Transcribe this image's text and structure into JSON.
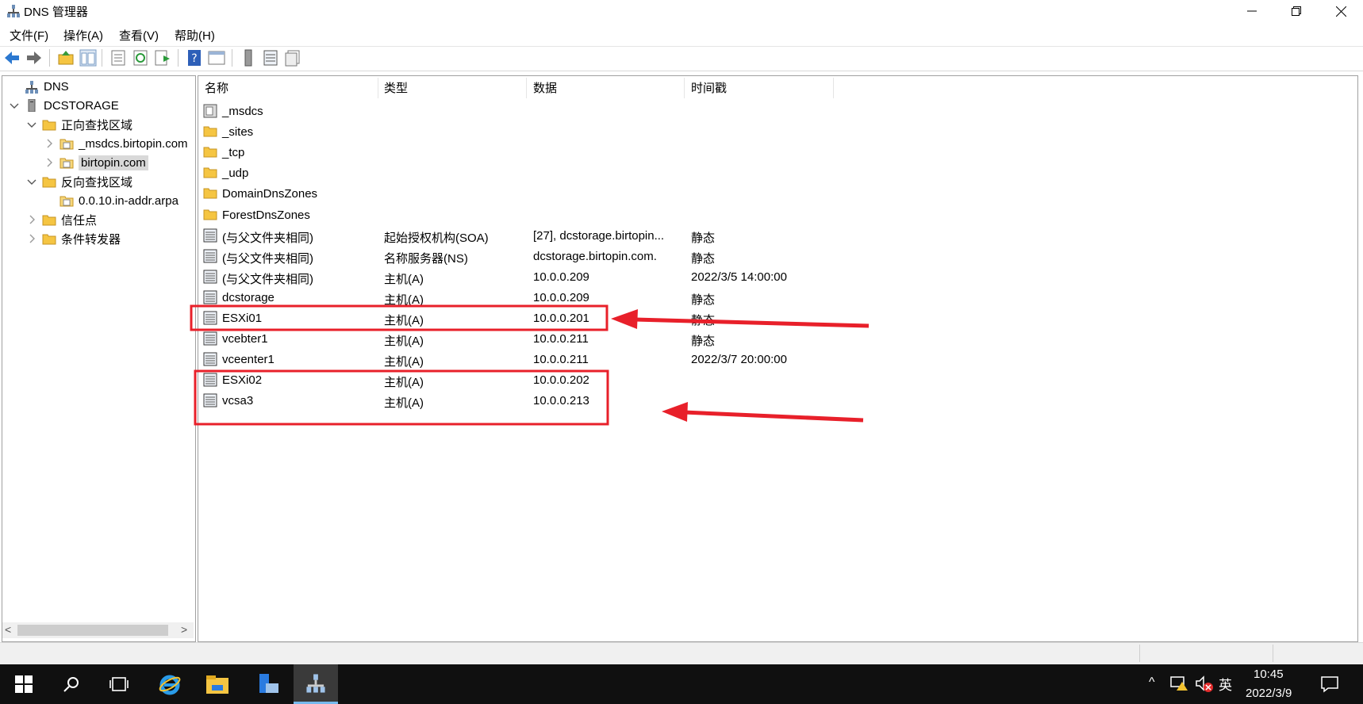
{
  "window": {
    "title": "DNS 管理器"
  },
  "menu": [
    "文件(F)",
    "操作(A)",
    "查看(V)",
    "帮助(H)"
  ],
  "tree": [
    {
      "label": "DNS",
      "level": 0,
      "expander": "",
      "icon": "dns-icon"
    },
    {
      "label": "DCSTORAGE",
      "level": 0,
      "expander": "v",
      "icon": "server-icon"
    },
    {
      "label": "正向查找区域",
      "level": 1,
      "expander": "v",
      "icon": "folder-icon"
    },
    {
      "label": "_msdcs.birtopin.com",
      "level": 2,
      "expander": ">",
      "icon": "zone-icon"
    },
    {
      "label": "birtopin.com",
      "level": 2,
      "expander": ">",
      "icon": "zone-icon",
      "selected": true
    },
    {
      "label": "反向查找区域",
      "level": 1,
      "expander": "v",
      "icon": "folder-icon"
    },
    {
      "label": "0.0.10.in-addr.arpa",
      "level": 2,
      "expander": "",
      "icon": "zone-icon"
    },
    {
      "label": "信任点",
      "level": 1,
      "expander": ">",
      "icon": "folder-icon"
    },
    {
      "label": "条件转发器",
      "level": 1,
      "expander": ">",
      "icon": "folder-icon"
    }
  ],
  "columns": [
    "名称",
    "类型",
    "数据",
    "时间戳"
  ],
  "rows": [
    {
      "name": "_msdcs",
      "type": "",
      "data": "",
      "timestamp": "",
      "icon": "delegated-zone-icon"
    },
    {
      "name": "_sites",
      "type": "",
      "data": "",
      "timestamp": "",
      "icon": "folder-icon"
    },
    {
      "name": "_tcp",
      "type": "",
      "data": "",
      "timestamp": "",
      "icon": "folder-icon"
    },
    {
      "name": "_udp",
      "type": "",
      "data": "",
      "timestamp": "",
      "icon": "folder-icon"
    },
    {
      "name": "DomainDnsZones",
      "type": "",
      "data": "",
      "timestamp": "",
      "icon": "folder-icon"
    },
    {
      "name": "ForestDnsZones",
      "type": "",
      "data": "",
      "timestamp": "",
      "icon": "folder-icon"
    },
    {
      "name": "(与父文件夹相同)",
      "type": "起始授权机构(SOA)",
      "data": "[27], dcstorage.birtopin...",
      "timestamp": "静态",
      "icon": "record-icon"
    },
    {
      "name": "(与父文件夹相同)",
      "type": "名称服务器(NS)",
      "data": "dcstorage.birtopin.com.",
      "timestamp": "静态",
      "icon": "record-icon"
    },
    {
      "name": "(与父文件夹相同)",
      "type": "主机(A)",
      "data": "10.0.0.209",
      "timestamp": "2022/3/5 14:00:00",
      "icon": "record-icon"
    },
    {
      "name": "dcstorage",
      "type": "主机(A)",
      "data": "10.0.0.209",
      "timestamp": "静态",
      "icon": "record-icon"
    },
    {
      "name": "ESXi01",
      "type": "主机(A)",
      "data": "10.0.0.201",
      "timestamp": "静态",
      "icon": "record-icon"
    },
    {
      "name": "vcebter1",
      "type": "主机(A)",
      "data": "10.0.0.211",
      "timestamp": "静态",
      "icon": "record-icon"
    },
    {
      "name": "vceenter1",
      "type": "主机(A)",
      "data": "10.0.0.211",
      "timestamp": "2022/3/7 20:00:00",
      "icon": "record-icon"
    },
    {
      "name": "ESXi02",
      "type": "主机(A)",
      "data": "10.0.0.202",
      "timestamp": "",
      "icon": "record-icon"
    },
    {
      "name": "vcsa3",
      "type": "主机(A)",
      "data": "10.0.0.213",
      "timestamp": "",
      "icon": "record-icon"
    }
  ],
  "taskbar": {
    "ime": "英",
    "time": "10:45",
    "date": "2022/3/9"
  },
  "colors": {
    "highlight": "#e8202a",
    "selection": "#d9d9d9",
    "taskbar": "#101010",
    "folder": "#f5c542"
  }
}
